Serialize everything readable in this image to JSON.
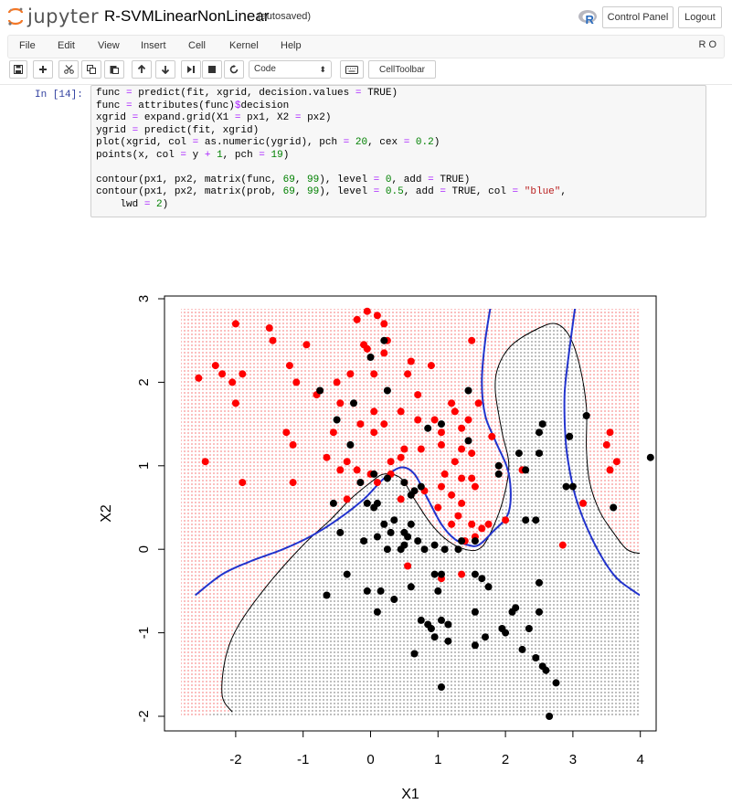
{
  "header": {
    "logo_text": "jupyter",
    "notebook_name": "R-SVMLinearNonLinear",
    "autosave_status": "(autosaved)",
    "control_panel_label": "Control Panel",
    "logout_label": "Logout",
    "kernel_logo_letter": "R"
  },
  "menubar": {
    "items": [
      "File",
      "Edit",
      "View",
      "Insert",
      "Cell",
      "Kernel",
      "Help"
    ],
    "kernel_indicator": "R O"
  },
  "toolbar": {
    "cell_type": "Code",
    "celltoolbar_label": "CellToolbar"
  },
  "cell": {
    "prompt": "In [14]:",
    "code_lines": [
      "func = predict(fit, xgrid, decision.values = TRUE)",
      "func = attributes(func)$decision",
      "xgrid = expand.grid(X1 = px1, X2 = px2)",
      "ygrid = predict(fit, xgrid)",
      "plot(xgrid, col = as.numeric(ygrid), pch = 20, cex = 0.2)",
      "points(x, col = y + 1, pch = 19)",
      "",
      "contour(px1, px2, matrix(func, 69, 99), level = 0, add = TRUE)",
      "contour(px1, px2, matrix(prob, 69, 99), level = 0.5, add = TRUE, col = \"blue\",",
      "    lwd = 2)"
    ]
  },
  "chart_data": {
    "type": "scatter",
    "title": "",
    "xlabel": "X1",
    "ylabel": "X2",
    "xlim": [
      -2.6,
      4.2
    ],
    "ylim": [
      -2.0,
      2.95
    ],
    "xticks": [
      -2,
      -1,
      0,
      1,
      2,
      3,
      4
    ],
    "yticks": [
      -2,
      -1,
      0,
      1,
      2,
      3
    ],
    "colors": {
      "class_red": "#ff0000",
      "class_black": "#000000",
      "contour_svm": "#000000",
      "contour_prob": "#2233cc"
    },
    "series": [
      {
        "points": [
          [
            -0.05,
            2.85
          ],
          [
            0.1,
            2.8
          ],
          [
            -0.2,
            2.75
          ],
          [
            -2.0,
            2.7
          ],
          [
            -1.5,
            2.65
          ],
          [
            0.2,
            2.7
          ],
          [
            -1.45,
            2.5
          ],
          [
            -0.95,
            2.45
          ],
          [
            -0.1,
            2.45
          ],
          [
            1.5,
            2.5
          ],
          [
            0.25,
            2.5
          ],
          [
            -0.05,
            2.4
          ],
          [
            -2.3,
            2.2
          ],
          [
            0.2,
            2.35
          ],
          [
            -1.2,
            2.2
          ],
          [
            -2.2,
            2.1
          ],
          [
            -1.9,
            2.1
          ],
          [
            -2.55,
            2.05
          ],
          [
            -2.05,
            2.0
          ],
          [
            -1.1,
            2.0
          ],
          [
            -0.5,
            2.0
          ],
          [
            -0.3,
            2.1
          ],
          [
            0.05,
            2.1
          ],
          [
            0.9,
            2.2
          ],
          [
            0.6,
            2.25
          ],
          [
            0.55,
            2.1
          ],
          [
            0.7,
            1.85
          ],
          [
            -0.8,
            1.85
          ],
          [
            -0.45,
            1.75
          ],
          [
            1.2,
            1.75
          ],
          [
            1.6,
            1.75
          ],
          [
            -2.0,
            1.75
          ],
          [
            0.45,
            1.65
          ],
          [
            0.7,
            1.55
          ],
          [
            0.95,
            1.55
          ],
          [
            0.05,
            1.65
          ],
          [
            1.25,
            1.65
          ],
          [
            1.45,
            1.55
          ],
          [
            1.35,
            1.45
          ],
          [
            0.2,
            1.5
          ],
          [
            -0.15,
            1.5
          ],
          [
            0.05,
            1.4
          ],
          [
            1.05,
            1.4
          ],
          [
            -0.55,
            1.4
          ],
          [
            1.8,
            1.35
          ],
          [
            -1.25,
            1.4
          ],
          [
            -1.15,
            1.25
          ],
          [
            1.05,
            1.25
          ],
          [
            1.35,
            1.2
          ],
          [
            0.5,
            1.2
          ],
          [
            0.45,
            1.1
          ],
          [
            0.75,
            1.2
          ],
          [
            1.5,
            1.15
          ],
          [
            0.3,
            1.05
          ],
          [
            1.25,
            1.05
          ],
          [
            -0.65,
            1.1
          ],
          [
            -0.35,
            1.05
          ],
          [
            -0.45,
            0.95
          ],
          [
            -0.2,
            0.95
          ],
          [
            0.0,
            0.9
          ],
          [
            0.1,
            0.8
          ],
          [
            0.3,
            0.9
          ],
          [
            1.1,
            0.9
          ],
          [
            1.5,
            0.85
          ],
          [
            1.35,
            0.85
          ],
          [
            1.05,
            0.75
          ],
          [
            1.2,
            0.65
          ],
          [
            1.55,
            0.75
          ],
          [
            0.8,
            0.7
          ],
          [
            1.35,
            0.55
          ],
          [
            0.45,
            0.6
          ],
          [
            1.0,
            0.5
          ],
          [
            1.3,
            0.4
          ],
          [
            1.2,
            0.3
          ],
          [
            1.5,
            0.3
          ],
          [
            1.65,
            0.25
          ],
          [
            1.75,
            0.3
          ],
          [
            1.55,
            0.15
          ],
          [
            1.4,
            0.1
          ],
          [
            2.0,
            0.35
          ],
          [
            0.55,
            -0.2
          ],
          [
            1.05,
            -0.35
          ],
          [
            1.35,
            -0.3
          ],
          [
            -1.9,
            0.8
          ],
          [
            -1.15,
            0.8
          ],
          [
            -2.45,
            1.05
          ],
          [
            3.55,
            1.4
          ],
          [
            3.65,
            1.05
          ],
          [
            3.5,
            1.25
          ],
          [
            3.55,
            0.95
          ],
          [
            3.15,
            0.55
          ],
          [
            2.85,
            0.05
          ],
          [
            2.25,
            0.95
          ],
          [
            -0.35,
            0.6
          ]
        ]
      },
      {
        "points": [
          [
            0.2,
            2.5
          ],
          [
            0.0,
            2.3
          ],
          [
            -0.75,
            1.9
          ],
          [
            0.25,
            1.9
          ],
          [
            1.45,
            1.9
          ],
          [
            -0.25,
            1.75
          ],
          [
            1.05,
            1.5
          ],
          [
            -0.5,
            1.55
          ],
          [
            2.55,
            1.5
          ],
          [
            2.5,
            1.4
          ],
          [
            0.85,
            1.45
          ],
          [
            -0.3,
            1.25
          ],
          [
            1.45,
            1.3
          ],
          [
            2.2,
            1.15
          ],
          [
            2.5,
            1.15
          ],
          [
            1.9,
            1.0
          ],
          [
            2.3,
            0.95
          ],
          [
            3.2,
            1.6
          ],
          [
            2.95,
            1.35
          ],
          [
            2.9,
            0.75
          ],
          [
            3.0,
            0.75
          ],
          [
            0.05,
            0.9
          ],
          [
            -0.15,
            0.8
          ],
          [
            0.25,
            0.85
          ],
          [
            0.5,
            0.8
          ],
          [
            0.65,
            0.7
          ],
          [
            0.75,
            0.75
          ],
          [
            0.6,
            0.65
          ],
          [
            -0.55,
            0.55
          ],
          [
            -0.05,
            0.55
          ],
          [
            0.1,
            0.55
          ],
          [
            0.35,
            0.35
          ],
          [
            0.6,
            0.3
          ],
          [
            0.2,
            0.3
          ],
          [
            0.3,
            0.2
          ],
          [
            0.5,
            0.2
          ],
          [
            -0.45,
            0.2
          ],
          [
            -0.1,
            0.1
          ],
          [
            0.1,
            0.15
          ],
          [
            0.55,
            0.15
          ],
          [
            0.7,
            0.1
          ],
          [
            0.25,
            0.0
          ],
          [
            0.45,
            0.0
          ],
          [
            0.5,
            0.05
          ],
          [
            0.8,
            0.0
          ],
          [
            0.95,
            0.05
          ],
          [
            1.35,
            0.1
          ],
          [
            1.55,
            0.1
          ],
          [
            1.3,
            0.0
          ],
          [
            1.1,
            0.0
          ],
          [
            2.3,
            0.35
          ],
          [
            2.45,
            0.35
          ],
          [
            3.6,
            0.5
          ],
          [
            0.6,
            -0.45
          ],
          [
            0.95,
            -0.3
          ],
          [
            1.05,
            -0.3
          ],
          [
            1.55,
            -0.3
          ],
          [
            1.65,
            -0.35
          ],
          [
            1.75,
            -0.45
          ],
          [
            -0.35,
            -0.3
          ],
          [
            -0.05,
            -0.5
          ],
          [
            0.15,
            -0.5
          ],
          [
            1.0,
            -0.5
          ],
          [
            -0.65,
            -0.55
          ],
          [
            0.35,
            -0.6
          ],
          [
            0.1,
            -0.75
          ],
          [
            0.75,
            -0.85
          ],
          [
            1.05,
            -0.85
          ],
          [
            1.55,
            -0.75
          ],
          [
            2.1,
            -0.75
          ],
          [
            2.15,
            -0.7
          ],
          [
            2.5,
            -0.75
          ],
          [
            2.5,
            -0.4
          ],
          [
            0.85,
            -0.9
          ],
          [
            0.9,
            -0.95
          ],
          [
            1.15,
            -0.9
          ],
          [
            1.95,
            -0.95
          ],
          [
            2.0,
            -1.0
          ],
          [
            2.35,
            -0.95
          ],
          [
            0.95,
            -1.05
          ],
          [
            1.15,
            -1.1
          ],
          [
            1.7,
            -1.05
          ],
          [
            0.65,
            -1.25
          ],
          [
            1.55,
            -1.15
          ],
          [
            2.25,
            -1.2
          ],
          [
            2.45,
            -1.3
          ],
          [
            2.55,
            -1.4
          ],
          [
            2.6,
            -1.45
          ],
          [
            2.75,
            -1.6
          ],
          [
            1.05,
            -1.65
          ],
          [
            2.65,
            -2.0
          ],
          [
            4.15,
            1.1
          ],
          [
            1.9,
            0.9
          ],
          [
            0.05,
            0.5
          ]
        ]
      }
    ]
  }
}
